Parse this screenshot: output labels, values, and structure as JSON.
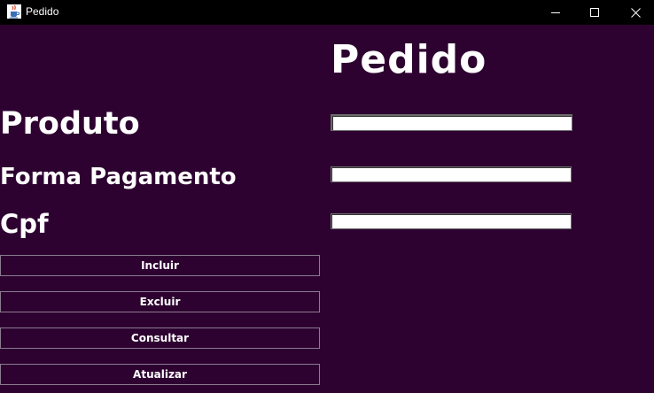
{
  "window": {
    "title": "Pedido",
    "icon": "java-cup-icon",
    "controls": {
      "minimize": "minimize-icon",
      "maximize": "maximize-icon",
      "close": "close-icon"
    }
  },
  "form": {
    "heading": "Pedido",
    "fields": {
      "produto": {
        "label": "Produto",
        "value": ""
      },
      "forma_pagamento": {
        "label": "Forma Pagamento",
        "value": ""
      },
      "cpf": {
        "label": "Cpf",
        "value": ""
      }
    },
    "buttons": {
      "incluir": "Incluir",
      "excluir": "Excluir",
      "consultar": "Consultar",
      "atualizar": "Atualizar"
    }
  },
  "colors": {
    "background": "#2e0230",
    "titlebar": "#000000",
    "text": "#ffffff",
    "button_border": "#8a7a90"
  }
}
